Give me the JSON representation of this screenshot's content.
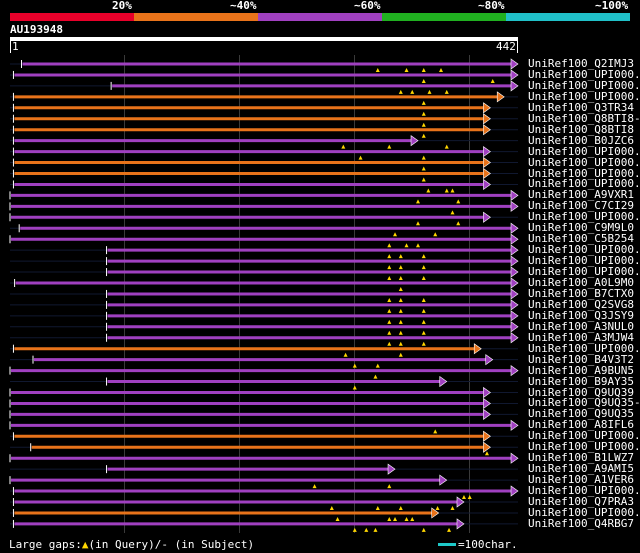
{
  "legend": {
    "labels": [
      "20%",
      "~40%",
      "~60%",
      "~80%",
      "~100%"
    ],
    "colors": [
      "#e8002a",
      "#e8731a",
      "#a040c0",
      "#20b020",
      "#20c0c8"
    ]
  },
  "query": {
    "name": "AU193948",
    "start_label": "1",
    "end_label": "442",
    "length": 442
  },
  "hits": [
    {
      "label": "UniRef100_Q2IMJ3",
      "color": "magenta",
      "from": 10,
      "to": 442,
      "gaps": [
        320,
        345,
        360,
        375
      ]
    },
    {
      "label": "UniRef100_UPI000..",
      "color": "magenta",
      "from": 3,
      "to": 442,
      "gaps": [
        360,
        420
      ]
    },
    {
      "label": "UniRef100_UPI000..",
      "color": "magenta",
      "from": 88,
      "to": 442,
      "gaps": [
        340,
        350,
        365,
        380
      ]
    },
    {
      "label": "UniRef100_UPI000..",
      "color": "orange",
      "from": 3,
      "to": 430,
      "gaps": [
        360
      ]
    },
    {
      "label": "UniRef100_Q3TR34",
      "color": "orange",
      "from": 3,
      "to": 418,
      "gaps": [
        360
      ]
    },
    {
      "label": "UniRef100_Q8BTI8-3",
      "color": "orange",
      "from": 3,
      "to": 418,
      "gaps": [
        360
      ]
    },
    {
      "label": "UniRef100_Q8BTI8",
      "color": "orange",
      "from": 3,
      "to": 418,
      "gaps": [
        360
      ]
    },
    {
      "label": "UniRef100_B0JZC6",
      "color": "magenta",
      "from": 3,
      "to": 355,
      "gaps": [
        290,
        330,
        380
      ]
    },
    {
      "label": "UniRef100_UPI000..",
      "color": "magenta",
      "from": 3,
      "to": 418,
      "gaps": [
        305,
        360
      ]
    },
    {
      "label": "UniRef100_UPI000..",
      "color": "orange",
      "from": 3,
      "to": 418,
      "gaps": [
        360
      ]
    },
    {
      "label": "UniRef100_UPI000..",
      "color": "orange",
      "from": 3,
      "to": 418,
      "gaps": [
        360
      ]
    },
    {
      "label": "UniRef100_UPI000..",
      "color": "magenta",
      "from": 3,
      "to": 418,
      "gaps": [
        364,
        380,
        385
      ]
    },
    {
      "label": "UniRef100_A9VXR1",
      "color": "magenta",
      "from": 0,
      "to": 442,
      "gaps": [
        355,
        390
      ]
    },
    {
      "label": "UniRef100_C7CI29",
      "color": "magenta",
      "from": 0,
      "to": 442,
      "gaps": [
        385
      ]
    },
    {
      "label": "UniRef100_UPI000..",
      "color": "magenta",
      "from": 0,
      "to": 418,
      "gaps": [
        355,
        390
      ]
    },
    {
      "label": "UniRef100_C9M9L0",
      "color": "magenta",
      "from": 8,
      "to": 442,
      "gaps": [
        335,
        370
      ]
    },
    {
      "label": "UniRef100_C5B254",
      "color": "magenta",
      "from": 0,
      "to": 442,
      "gaps": [
        330,
        345,
        355
      ]
    },
    {
      "label": "UniRef100_UPI000..",
      "color": "magenta",
      "from": 84,
      "to": 442,
      "gaps": [
        330,
        340,
        360
      ]
    },
    {
      "label": "UniRef100_UPI000..",
      "color": "magenta",
      "from": 84,
      "to": 442,
      "gaps": [
        330,
        340,
        360
      ]
    },
    {
      "label": "UniRef100_UPI000..",
      "color": "magenta",
      "from": 84,
      "to": 442,
      "gaps": [
        330,
        340,
        360
      ]
    },
    {
      "label": "UniRef100_A0L9M0",
      "color": "magenta",
      "from": 4,
      "to": 442,
      "gaps": [
        340
      ]
    },
    {
      "label": "UniRef100_B7CTX0",
      "color": "magenta",
      "from": 84,
      "to": 442,
      "gaps": [
        330,
        340,
        360
      ]
    },
    {
      "label": "UniRef100_Q2SVG8",
      "color": "magenta",
      "from": 84,
      "to": 442,
      "gaps": [
        330,
        340,
        360
      ]
    },
    {
      "label": "UniRef100_Q3JSY9",
      "color": "magenta",
      "from": 84,
      "to": 442,
      "gaps": [
        330,
        340,
        360
      ]
    },
    {
      "label": "UniRef100_A3NUL0",
      "color": "magenta",
      "from": 84,
      "to": 442,
      "gaps": [
        330,
        340,
        360
      ]
    },
    {
      "label": "UniRef100_A3MJW4",
      "color": "magenta",
      "from": 84,
      "to": 442,
      "gaps": [
        330,
        340,
        360
      ]
    },
    {
      "label": "UniRef100_UPI000..",
      "color": "orange",
      "from": 3,
      "to": 410,
      "gaps": [
        292,
        340
      ]
    },
    {
      "label": "UniRef100_B4V3T2",
      "color": "magenta",
      "from": 20,
      "to": 420,
      "gaps": [
        300,
        320
      ]
    },
    {
      "label": "UniRef100_A9BUN5",
      "color": "magenta",
      "from": 0,
      "to": 442,
      "gaps": [
        318
      ]
    },
    {
      "label": "UniRef100_B9AY35",
      "color": "magenta",
      "from": 84,
      "to": 380,
      "gaps": [
        300
      ]
    },
    {
      "label": "UniRef100_Q9UQ39",
      "color": "magenta",
      "from": 0,
      "to": 418,
      "gaps": []
    },
    {
      "label": "UniRef100_Q9UQ35-2",
      "color": "magenta",
      "from": 0,
      "to": 418,
      "gaps": []
    },
    {
      "label": "UniRef100_Q9UQ35",
      "color": "magenta",
      "from": 0,
      "to": 418,
      "gaps": []
    },
    {
      "label": "UniRef100_A8IFL6",
      "color": "magenta",
      "from": 0,
      "to": 442,
      "gaps": [
        370
      ]
    },
    {
      "label": "UniRef100_UPI000..",
      "color": "orange",
      "from": 3,
      "to": 418,
      "gaps": []
    },
    {
      "label": "UniRef100_UPI000..",
      "color": "orange",
      "from": 18,
      "to": 418,
      "gaps": [
        415
      ]
    },
    {
      "label": "UniRef100_B1LWZ7",
      "color": "magenta",
      "from": 0,
      "to": 442,
      "gaps": []
    },
    {
      "label": "UniRef100_A9AMI5",
      "color": "magenta",
      "from": 84,
      "to": 335,
      "gaps": []
    },
    {
      "label": "UniRef100_A1VER6",
      "color": "magenta",
      "from": 0,
      "to": 380,
      "gaps": [
        265,
        330
      ]
    },
    {
      "label": "UniRef100_UPI000..",
      "color": "magenta",
      "from": 3,
      "to": 442,
      "gaps": [
        395,
        400
      ]
    },
    {
      "label": "UniRef100_Q7PRA3",
      "color": "magenta",
      "from": 3,
      "to": 395,
      "gaps": [
        280,
        320,
        340,
        372,
        385
      ]
    },
    {
      "label": "UniRef100_UPI000..",
      "color": "orange",
      "from": 3,
      "to": 373,
      "gaps": [
        285,
        330,
        335,
        345,
        350
      ]
    },
    {
      "label": "UniRef100_Q4RBG7",
      "color": "magenta",
      "from": 3,
      "to": 395,
      "gaps": [
        300,
        310,
        318,
        360,
        382
      ]
    }
  ],
  "footer": {
    "text_prefix": "Large gaps:",
    "gap_query_text": "(in Query)/-",
    "gap_subject_text": "(in Subject)",
    "scale_text": "=100char."
  }
}
